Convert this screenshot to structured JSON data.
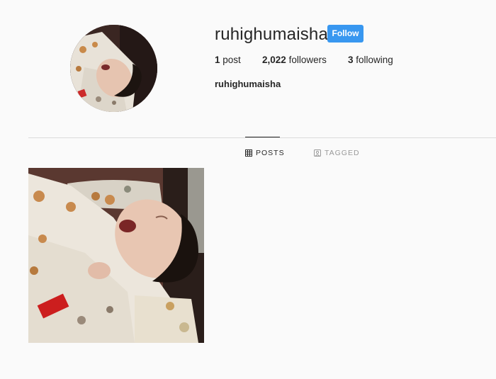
{
  "profile": {
    "username": "ruhighumaisha",
    "full_name": "ruhighumaisha",
    "follow_label": "Follow",
    "stats": {
      "posts_count": "1",
      "posts_label": "post",
      "followers_count": "2,022",
      "followers_label": "followers",
      "following_count": "3",
      "following_label": "following"
    },
    "avatar_alt": "Profile photo of a newborn baby"
  },
  "tabs": [
    {
      "label": "POSTS",
      "icon": "grid-icon",
      "active": true
    },
    {
      "label": "TAGGED",
      "icon": "tag-icon",
      "active": false
    }
  ],
  "posts": [
    {
      "alt": "Newborn baby crying, wrapped in a patterned blanket"
    }
  ],
  "colors": {
    "background": "#fafafa",
    "follow_button": "#3897f0",
    "divider": "#dbdbdb",
    "text": "#262626",
    "muted": "#999999"
  }
}
